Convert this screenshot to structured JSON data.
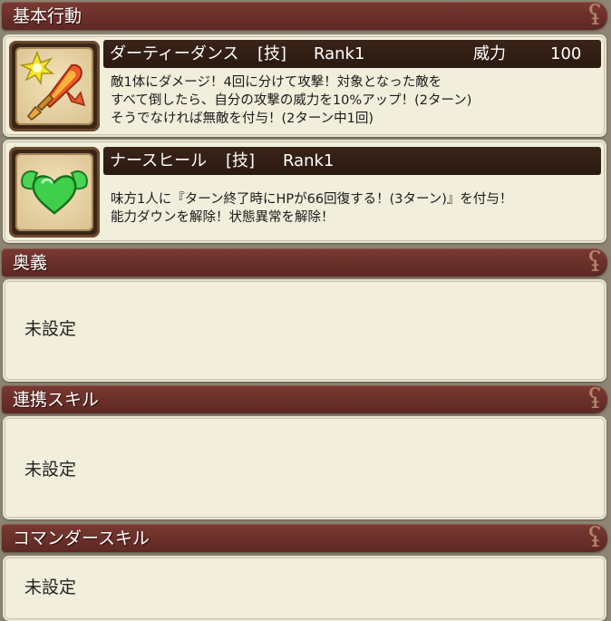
{
  "sections": {
    "basic": {
      "title": "基本行動"
    },
    "ougi": {
      "title": "奥義",
      "value": "未設定"
    },
    "renkei": {
      "title": "連携スキル",
      "value": "未設定"
    },
    "commander": {
      "title": "コマンダースキル",
      "value": "未設定"
    }
  },
  "skills": [
    {
      "icon": "flaming-sword-icon",
      "name": "ダーティーダンス",
      "type": "[技]",
      "rank": "Rank1",
      "power_label": "威力",
      "power_value": "100",
      "desc": [
        "敵1体にダメージ！4回に分けて攻撃！対象となった敵を",
        "すべて倒したら、自分の攻撃の威力を10%アップ！(2ターン)",
        "そうでなければ無敵を付与！(2ターン中1回)"
      ]
    },
    {
      "icon": "winged-heart-icon",
      "name": "ナースヒール",
      "type": "[技]",
      "rank": "Rank1",
      "desc": [
        "味方1人に『ターン終了時にHPが66回復する！(3ターン)』を付与！",
        "能力ダウンを解除！状態異常を解除！"
      ]
    }
  ],
  "colors": {
    "header": "#6a2f2a",
    "card": "#f2eedc",
    "skill_bar": "#2a1910",
    "heart": "#3fcf4a",
    "sword": "#e5562e",
    "spark": "#f1e02a"
  }
}
